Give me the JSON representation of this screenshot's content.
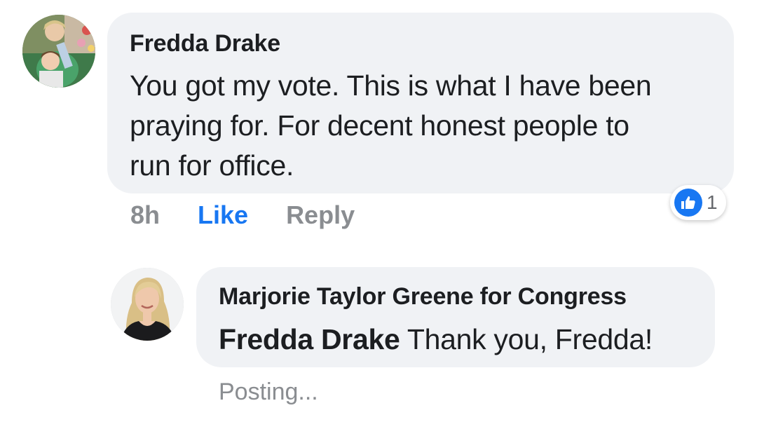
{
  "comment": {
    "author": "Fredda Drake",
    "text": "You got my vote. This is what I have been praying for. For decent honest people to run for office.",
    "time": "8h",
    "like_label": "Like",
    "reply_label": "Reply",
    "reaction": {
      "icon": "thumbs-up-icon",
      "count": "1",
      "color": "#1877f2"
    }
  },
  "reply": {
    "author": "Marjorie Taylor Greene for Congress",
    "mention": "Fredda Drake",
    "text": "Thank you, Fredda!",
    "status": "Posting..."
  },
  "colors": {
    "bubble": "#f0f2f5",
    "text": "#1c1e21",
    "muted": "#8a8d91",
    "accent": "#1877f2"
  }
}
